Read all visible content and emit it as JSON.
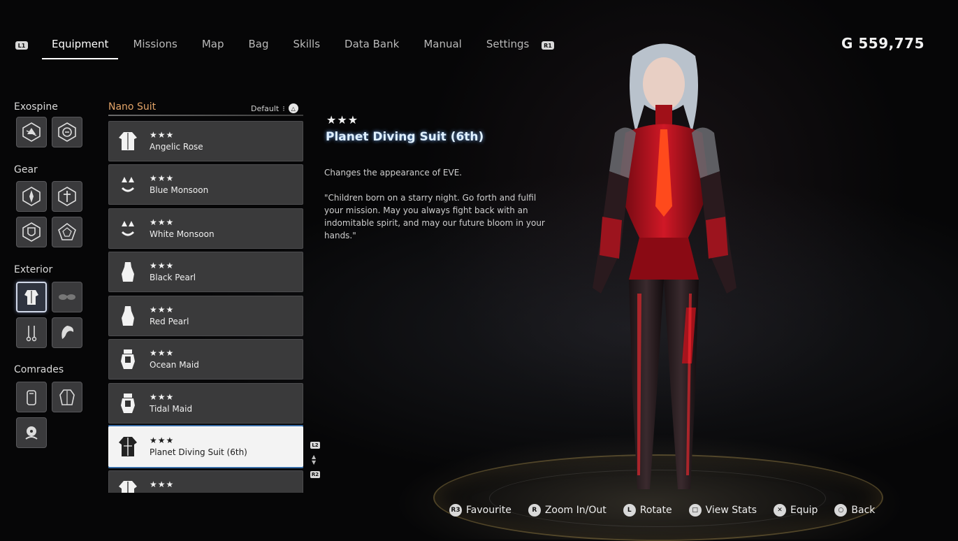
{
  "nav": {
    "left_trigger": "L1",
    "right_trigger": "R1",
    "tabs": [
      {
        "label": "Equipment",
        "active": true
      },
      {
        "label": "Missions"
      },
      {
        "label": "Map"
      },
      {
        "label": "Bag"
      },
      {
        "label": "Skills"
      },
      {
        "label": "Data Bank"
      },
      {
        "label": "Manual"
      },
      {
        "label": "Settings"
      }
    ]
  },
  "currency": {
    "text": "G 559,775"
  },
  "categories": {
    "exospine": "Exospine",
    "gear": "Gear",
    "exterior": "Exterior",
    "comrades": "Comrades"
  },
  "list": {
    "title": "Nano Suit",
    "sort_label": "Default",
    "sort_button": "△",
    "items": [
      {
        "stars": "★★★",
        "name": "Angelic Rose",
        "icon": "jacket-icon"
      },
      {
        "stars": "★★★",
        "name": "Blue Monsoon",
        "icon": "bikini-icon"
      },
      {
        "stars": "★★★",
        "name": "White Monsoon",
        "icon": "bikini-icon"
      },
      {
        "stars": "★★★",
        "name": "Black Pearl",
        "icon": "dress-icon"
      },
      {
        "stars": "★★★",
        "name": "Red Pearl",
        "icon": "dress-icon"
      },
      {
        "stars": "★★★",
        "name": "Ocean Maid",
        "icon": "maid-outfit-icon"
      },
      {
        "stars": "★★★",
        "name": "Tidal Maid",
        "icon": "maid-outfit-icon"
      },
      {
        "stars": "★★★",
        "name": "Planet Diving Suit (6th)",
        "icon": "diving-suit-icon",
        "selected": true
      },
      {
        "stars": "★★★",
        "name": "",
        "icon": "diving-suit-icon"
      }
    ],
    "scroll_up_trigger": "L2",
    "scroll_down_trigger": "R2"
  },
  "detail": {
    "stars": "★★★",
    "name": "Planet Diving Suit (6th)",
    "description": "Changes the appearance of EVE.",
    "quote": "\"Children born on a starry night. Go forth and fulfil your mission. May you always fight back with an indomitable spirit, and may our future bloom in your hands.\""
  },
  "prompts": [
    {
      "button": "R3",
      "label": "Favourite"
    },
    {
      "button": "R",
      "label": "Zoom In/Out"
    },
    {
      "button": "L",
      "label": "Rotate"
    },
    {
      "button": "□",
      "label": "View Stats"
    },
    {
      "button": "✕",
      "label": "Equip"
    },
    {
      "button": "○",
      "label": "Back"
    }
  ],
  "colors": {
    "accent_orange": "#e3a468",
    "selected_glow": "#dff0ff",
    "suit_red": "#c4121c"
  }
}
